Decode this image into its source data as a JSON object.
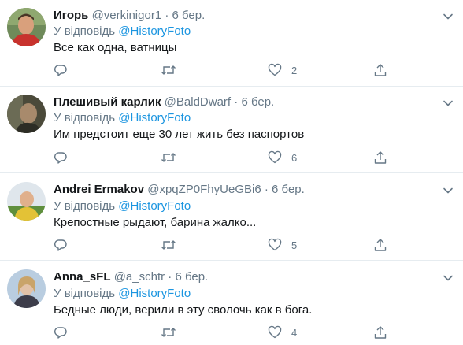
{
  "tweets": [
    {
      "name": "Игорь",
      "handle": "@verkinigor1",
      "dot": "·",
      "date": "6 бер.",
      "reply_prefix": "У відповідь ",
      "reply_mention": "@HistoryFoto",
      "text": "Все как одна, ватницы",
      "likes": "2"
    },
    {
      "name": "Плешивый карлик",
      "handle": "@BaldDwarf",
      "dot": "·",
      "date": "6 бер.",
      "reply_prefix": "У відповідь ",
      "reply_mention": "@HistoryFoto",
      "text": "Им предстоит еще 30 лет жить без паспортов",
      "likes": "6"
    },
    {
      "name": "Andrei Ermakov",
      "handle": "@xpqZP0FhyUeGBi6",
      "dot": "·",
      "date": "6 бер.",
      "reply_prefix": "У відповідь ",
      "reply_mention": "@HistoryFoto",
      "text": "Крепостные рыдают, барина жалко...",
      "likes": "5"
    },
    {
      "name": "Anna_sFL",
      "handle": "@a_schtr",
      "dot": "·",
      "date": "6 бер.",
      "reply_prefix": "У відповідь ",
      "reply_mention": "@HistoryFoto",
      "text": "Бедные люди, верили в эту сволочь как в бога.",
      "likes": "4"
    }
  ],
  "icons": {
    "reply": "reply-icon",
    "retweet": "retweet-icon",
    "like": "heart-icon",
    "share": "share-icon",
    "menu": "chevron-down-icon"
  },
  "colors": {
    "text": "#14171a",
    "muted": "#657786",
    "link": "#1b95e0",
    "divider": "#e6ecf0"
  }
}
